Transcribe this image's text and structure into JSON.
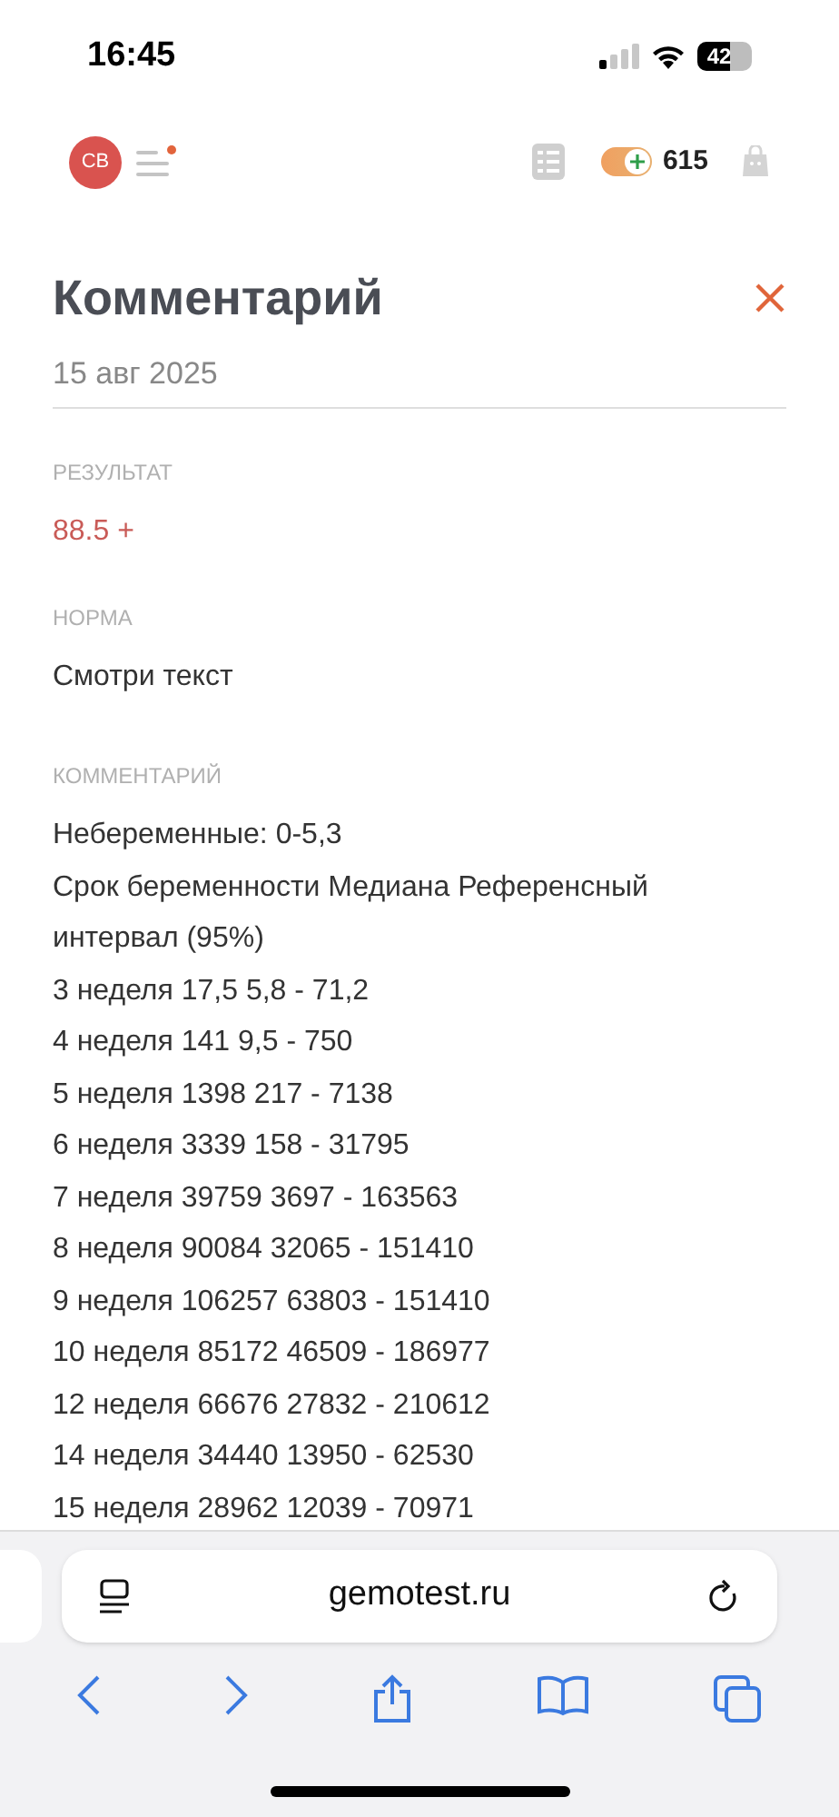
{
  "status_bar": {
    "time": "16:45",
    "battery": "42"
  },
  "header": {
    "avatar": "СВ",
    "menu_badge": true,
    "points": "615"
  },
  "title": "Комментарий",
  "date": "15 авг 2025",
  "sections": [
    {
      "label": "РЕЗУЛЬТАТ",
      "value": "88.5 +",
      "abnormal": true
    },
    {
      "label": "НОРМА",
      "value": "Смотри текст",
      "abnormal": false
    }
  ],
  "comment": {
    "label": "КОММЕНТАРИЙ",
    "lines": [
      "Небеременные: 0-5,3",
      "Срок беременности Медиана Референсный интервал (95%)",
      "3 неделя 17,5 5,8 - 71,2",
      "4 неделя 141 9,5 - 750",
      "5 неделя 1398 217 - 7138",
      "6 неделя 3339 158 - 31795",
      "7 неделя 39759 3697 - 163563",
      "8 неделя 90084 32065 - 151410",
      "9 неделя 106257 63803 - 151410",
      "10 неделя 85172 46509 - 186977",
      "12 неделя 66676 27832 - 210612",
      "14 неделя 34440 13950 - 62530",
      "15 неделя 28962 12039 - 70971"
    ]
  },
  "browser": {
    "url": "gemotest.ru"
  }
}
